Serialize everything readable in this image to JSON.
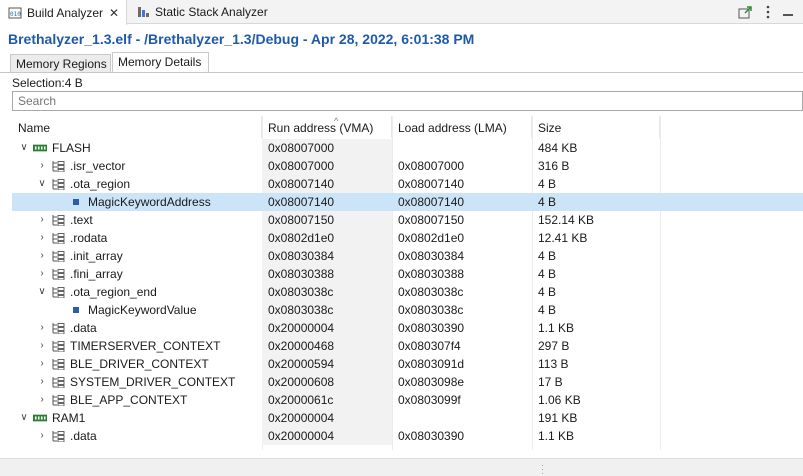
{
  "tabs": [
    {
      "label": "Build Analyzer",
      "active": true
    },
    {
      "label": "Static Stack Analyzer",
      "active": false
    }
  ],
  "editor_title": "Brethalyzer_1.3.elf - /Brethalyzer_1.3/Debug - Apr 28, 2022, 6:01:38 PM",
  "subtabs": [
    {
      "label": "Memory Regions",
      "active": false
    },
    {
      "label": "Memory Details",
      "active": true
    }
  ],
  "selection": "Selection:4 B",
  "search": {
    "placeholder": "Search"
  },
  "columns": {
    "name": "Name",
    "vma": "Run address (VMA)",
    "lma": "Load address (LMA)",
    "size": "Size"
  },
  "rows": [
    {
      "level": 0,
      "expander": "open",
      "icon": "memory-icon",
      "name": "FLASH",
      "vma": "0x08007000",
      "lma": "",
      "size": "484 KB"
    },
    {
      "level": 1,
      "expander": "closed",
      "icon": "section-icon",
      "name": ".isr_vector",
      "vma": "0x08007000",
      "lma": "0x08007000",
      "size": "316 B"
    },
    {
      "level": 1,
      "expander": "open",
      "icon": "section-icon",
      "name": ".ota_region",
      "vma": "0x08007140",
      "lma": "0x08007140",
      "size": "4 B"
    },
    {
      "level": 2,
      "expander": "none",
      "icon": "symbol-icon",
      "name": "MagicKeywordAddress",
      "vma": "0x08007140",
      "lma": "0x08007140",
      "size": "4 B",
      "selected": true
    },
    {
      "level": 1,
      "expander": "closed",
      "icon": "section-icon",
      "name": ".text",
      "vma": "0x08007150",
      "lma": "0x08007150",
      "size": "152.14 KB"
    },
    {
      "level": 1,
      "expander": "closed",
      "icon": "section-icon",
      "name": ".rodata",
      "vma": "0x0802d1e0",
      "lma": "0x0802d1e0",
      "size": "12.41 KB"
    },
    {
      "level": 1,
      "expander": "closed",
      "icon": "section-icon",
      "name": ".init_array",
      "vma": "0x08030384",
      "lma": "0x08030384",
      "size": "4 B"
    },
    {
      "level": 1,
      "expander": "closed",
      "icon": "section-icon",
      "name": ".fini_array",
      "vma": "0x08030388",
      "lma": "0x08030388",
      "size": "4 B"
    },
    {
      "level": 1,
      "expander": "open",
      "icon": "section-icon",
      "name": ".ota_region_end",
      "vma": "0x0803038c",
      "lma": "0x0803038c",
      "size": "4 B"
    },
    {
      "level": 2,
      "expander": "none",
      "icon": "symbol-icon",
      "name": "MagicKeywordValue",
      "vma": "0x0803038c",
      "lma": "0x0803038c",
      "size": "4 B"
    },
    {
      "level": 1,
      "expander": "closed",
      "icon": "section-icon",
      "name": ".data",
      "vma": "0x20000004",
      "lma": "0x08030390",
      "size": "1.1 KB"
    },
    {
      "level": 1,
      "expander": "closed",
      "icon": "section-icon",
      "name": "TIMERSERVER_CONTEXT",
      "vma": "0x20000468",
      "lma": "0x080307f4",
      "size": "297 B"
    },
    {
      "level": 1,
      "expander": "closed",
      "icon": "section-icon",
      "name": "BLE_DRIVER_CONTEXT",
      "vma": "0x20000594",
      "lma": "0x0803091d",
      "size": "113 B"
    },
    {
      "level": 1,
      "expander": "closed",
      "icon": "section-icon",
      "name": "SYSTEM_DRIVER_CONTEXT",
      "vma": "0x20000608",
      "lma": "0x0803098e",
      "size": "17 B"
    },
    {
      "level": 1,
      "expander": "closed",
      "icon": "section-icon",
      "name": "BLE_APP_CONTEXT",
      "vma": "0x2000061c",
      "lma": "0x0803099f",
      "size": "1.06 KB"
    },
    {
      "level": 0,
      "expander": "open",
      "icon": "memory-icon",
      "name": "RAM1",
      "vma": "0x20000004",
      "lma": "",
      "size": "191 KB"
    },
    {
      "level": 1,
      "expander": "closed",
      "icon": "section-icon",
      "name": ".data",
      "vma": "0x20000004",
      "lma": "0x08030390",
      "size": "1.1 KB"
    }
  ],
  "colors": {
    "title": "#1f5aa8",
    "selected_row": "#cce4f7",
    "memory_icon": "#2e8b3a"
  }
}
